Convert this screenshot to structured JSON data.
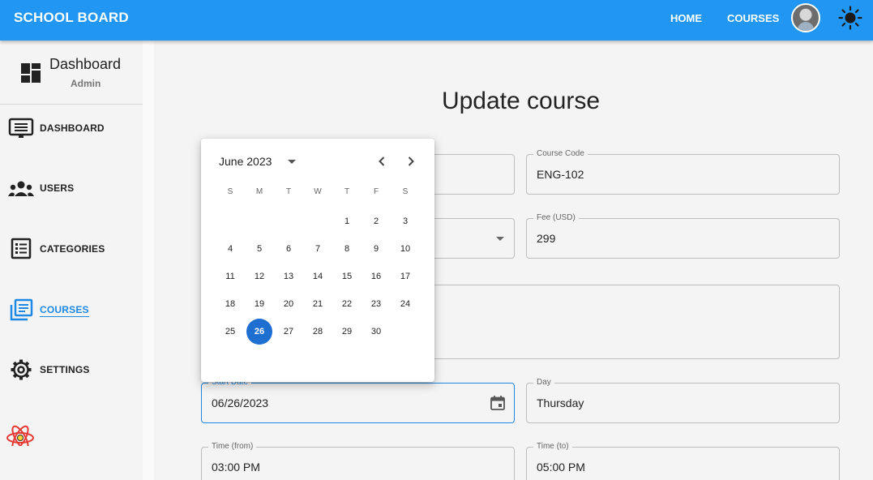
{
  "appbar": {
    "brand": "SCHOOL BOARD",
    "nav": [
      {
        "label": "HOME"
      },
      {
        "label": "COURSES"
      }
    ],
    "accent_color": "#2196f3"
  },
  "sidebar": {
    "header": {
      "title": "Dashboard",
      "subtitle": "Admin"
    },
    "items": [
      {
        "label": "DASHBOARD",
        "icon": "monitor-icon"
      },
      {
        "label": "USERS",
        "icon": "users-icon"
      },
      {
        "label": "CATEGORIES",
        "icon": "list-icon"
      },
      {
        "label": "COURSES",
        "icon": "courses-icon",
        "active": true
      },
      {
        "label": "SETTINGS",
        "icon": "gear-icon"
      }
    ]
  },
  "main": {
    "title": "Update course",
    "fields": {
      "course_code": {
        "label": "Course Code",
        "value": "ENG-102"
      },
      "fee": {
        "label": "Fee (USD)",
        "value": "299"
      },
      "start_date": {
        "label": "Start Date",
        "value": "06/26/2023"
      },
      "day": {
        "label": "Day",
        "value": "Thursday"
      },
      "time_from": {
        "label": "Time (from)",
        "value": "03:00 PM"
      },
      "time_to": {
        "label": "Time (to)",
        "value": "05:00 PM"
      }
    }
  },
  "datepicker": {
    "month_label": "June 2023",
    "weekdays": [
      "S",
      "M",
      "T",
      "W",
      "T",
      "F",
      "S"
    ],
    "first_weekday_index": 4,
    "days_in_month": 30,
    "selected_day": 26,
    "selected_color": "#1e6fd0"
  }
}
